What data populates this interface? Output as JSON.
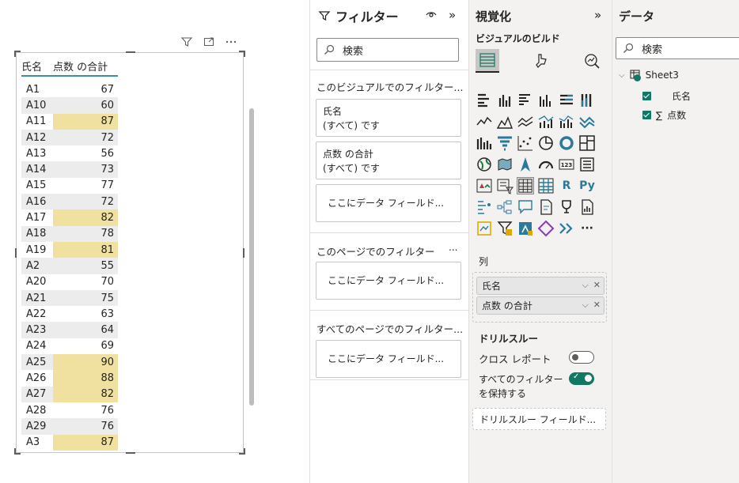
{
  "table": {
    "header": {
      "name": "氏名",
      "score": "点数 の合計"
    },
    "rows": [
      {
        "name": "A1",
        "score": "67",
        "hl": false
      },
      {
        "name": "A10",
        "score": "60",
        "hl": false
      },
      {
        "name": "A11",
        "score": "87",
        "hl": true
      },
      {
        "name": "A12",
        "score": "72",
        "hl": false
      },
      {
        "name": "A13",
        "score": "56",
        "hl": false
      },
      {
        "name": "A14",
        "score": "73",
        "hl": false
      },
      {
        "name": "A15",
        "score": "77",
        "hl": false
      },
      {
        "name": "A16",
        "score": "72",
        "hl": false
      },
      {
        "name": "A17",
        "score": "82",
        "hl": true
      },
      {
        "name": "A18",
        "score": "78",
        "hl": false
      },
      {
        "name": "A19",
        "score": "81",
        "hl": true
      },
      {
        "name": "A2",
        "score": "55",
        "hl": false
      },
      {
        "name": "A20",
        "score": "70",
        "hl": false
      },
      {
        "name": "A21",
        "score": "75",
        "hl": false
      },
      {
        "name": "A22",
        "score": "63",
        "hl": false
      },
      {
        "name": "A23",
        "score": "64",
        "hl": false
      },
      {
        "name": "A24",
        "score": "69",
        "hl": false
      },
      {
        "name": "A25",
        "score": "90",
        "hl": true
      },
      {
        "name": "A26",
        "score": "88",
        "hl": true
      },
      {
        "name": "A27",
        "score": "82",
        "hl": true
      },
      {
        "name": "A28",
        "score": "76",
        "hl": false
      },
      {
        "name": "A29",
        "score": "76",
        "hl": false
      },
      {
        "name": "A3",
        "score": "87",
        "hl": true
      }
    ]
  },
  "filters": {
    "title": "フィルター",
    "search_placeholder": "検索",
    "visual_section": "このビジュアルでのフィルター...",
    "cards": [
      {
        "field": "氏名",
        "state": "(すべて) です"
      },
      {
        "field": "点数 の合計",
        "state": "(すべて) です"
      }
    ],
    "drop_text": "ここにデータ フィールド...",
    "page_section": "このページでのフィルター",
    "all_pages_section": "すべてのページでのフィルター...",
    "more": "..."
  },
  "viz": {
    "title": "視覚化",
    "subtitle": "ビジュアルのビルド",
    "columns_label": "列",
    "wells": [
      "氏名",
      "点数 の合計"
    ],
    "drill_title": "ドリルスルー",
    "cross_report": "クロス レポート",
    "keep_filters_1": "すべてのフィルター",
    "keep_filters_2": "を保持する",
    "drill_field": "ドリルスルー フィールド...",
    "r_label": "R",
    "py_label": "Py",
    "more": "···"
  },
  "data_pane": {
    "title": "データ",
    "search_placeholder": "検索",
    "table_name": "Sheet3",
    "fields": [
      "氏名",
      "点数"
    ],
    "sigma": "∑"
  },
  "colors": {
    "accent": "#117865",
    "highlight": "#f0e1a0",
    "header_line": "#3a8fa8"
  }
}
